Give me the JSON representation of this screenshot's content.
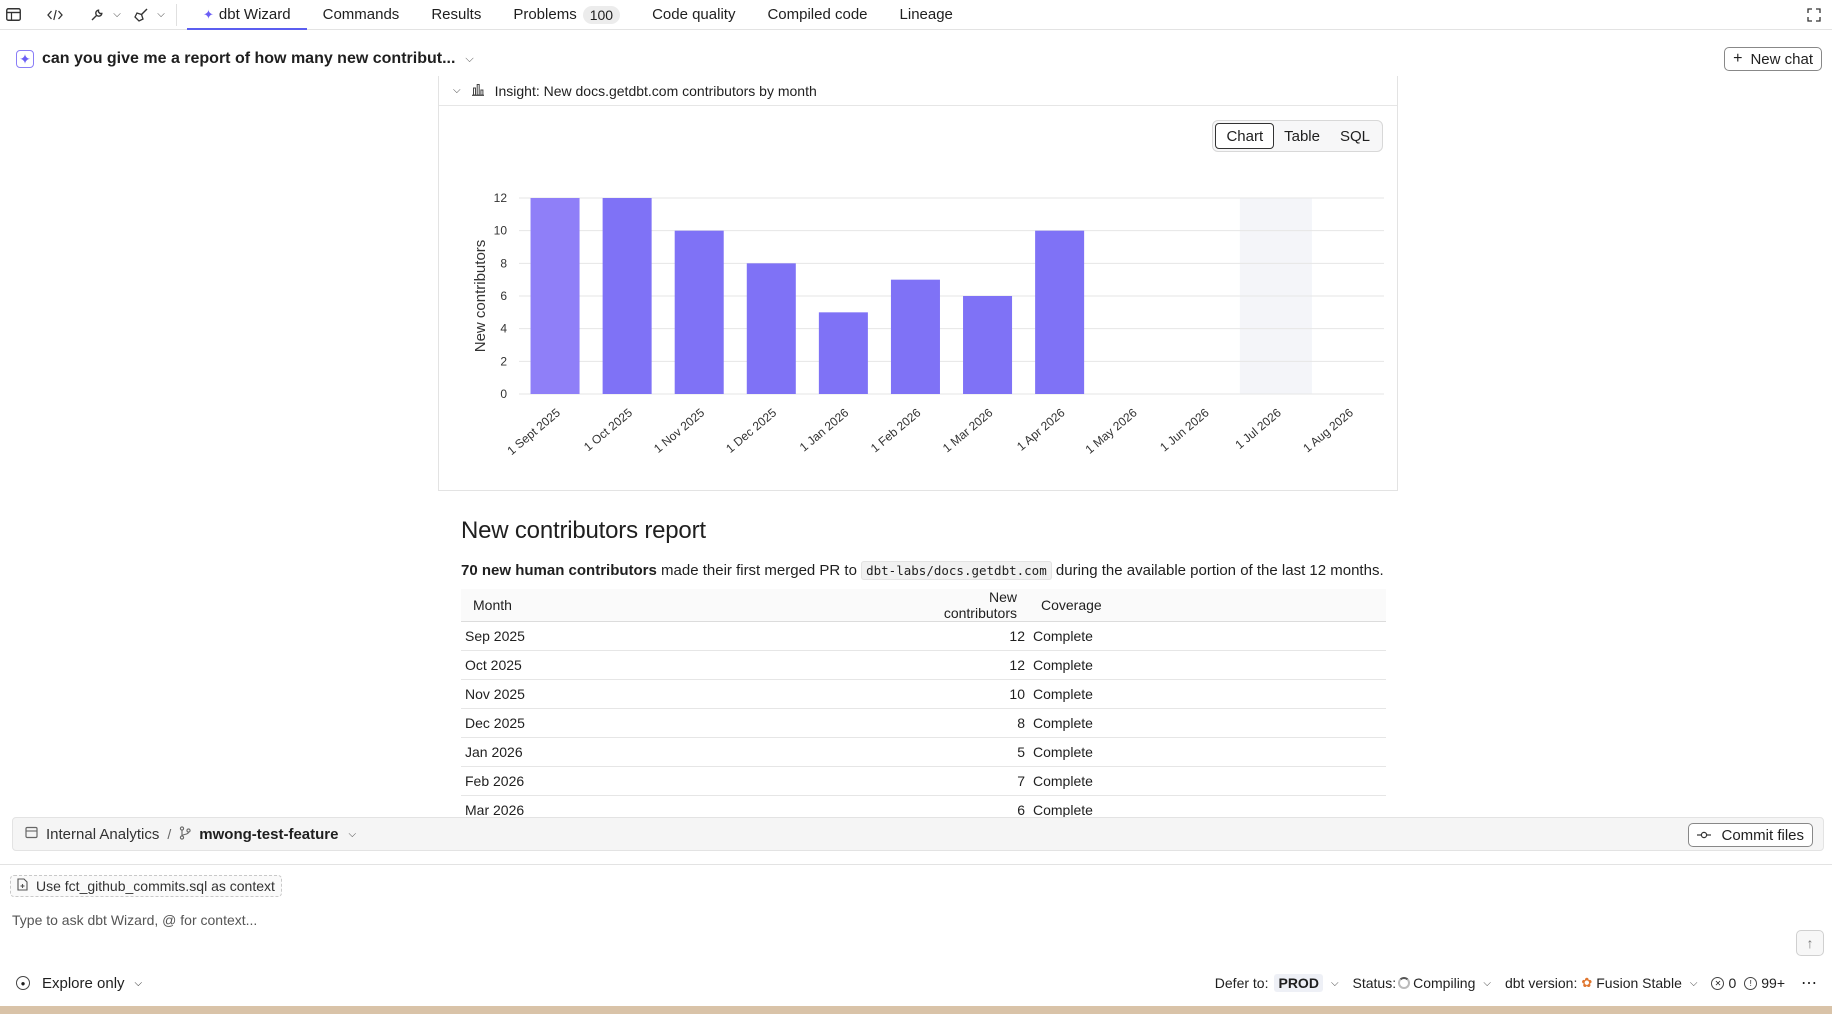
{
  "toolbar": {
    "icons": [
      "table-icon",
      "code-icon",
      "wrench-icon",
      "broom-icon"
    ],
    "tabs": [
      {
        "label": "dbt Wizard",
        "active": true
      },
      {
        "label": "Commands"
      },
      {
        "label": "Results"
      },
      {
        "label": "Problems",
        "badge": "100"
      },
      {
        "label": "Code quality"
      },
      {
        "label": "Compiled code"
      },
      {
        "label": "Lineage"
      }
    ]
  },
  "chat": {
    "title": "can you give me a report of how many new contribut...",
    "new_chat_label": "New chat"
  },
  "insight": {
    "title": "Insight: New docs.getdbt.com contributors by month",
    "view_options": [
      "Chart",
      "Table",
      "SQL"
    ],
    "active_view": "Chart"
  },
  "chart_data": {
    "type": "bar",
    "categories": [
      "1 Sept 2025",
      "1 Oct 2025",
      "1 Nov 2025",
      "1 Dec 2025",
      "1 Jan 2026",
      "1 Feb 2026",
      "1 Mar 2026",
      "1 Apr 2026",
      "1 May 2026",
      "1 Jun 2026",
      "1 Jul 2026",
      "1 Aug 2026"
    ],
    "values": [
      12,
      12,
      10,
      8,
      5,
      7,
      6,
      10,
      null,
      null,
      null,
      null
    ],
    "ylabel": "New contributors",
    "xlabel": "",
    "ylim": [
      0,
      12
    ],
    "yticks": [
      0,
      2,
      4,
      6,
      8,
      10,
      12
    ],
    "grid": true,
    "highlighted_category": "1 Jul 2026",
    "bar_color": "#7f72f6",
    "first_bar_color": "#8f7ff8"
  },
  "report": {
    "heading": "New contributors report",
    "summary_bold": "70 new human contributors",
    "summary_mid": " made their first merged PR to ",
    "summary_code": "dbt-labs/docs.getdbt.com",
    "summary_end": " during the available portion of the last 12 months.",
    "columns": [
      "Month",
      "New contributors",
      "Coverage"
    ],
    "rows": [
      {
        "month": "Sep 2025",
        "count": "12",
        "coverage": "Complete"
      },
      {
        "month": "Oct 2025",
        "count": "12",
        "coverage": "Complete"
      },
      {
        "month": "Nov 2025",
        "count": "10",
        "coverage": "Complete"
      },
      {
        "month": "Dec 2025",
        "count": "8",
        "coverage": "Complete"
      },
      {
        "month": "Jan 2026",
        "count": "5",
        "coverage": "Complete"
      },
      {
        "month": "Feb 2026",
        "count": "7",
        "coverage": "Complete"
      },
      {
        "month": "Mar 2026",
        "count": "6",
        "coverage": "Complete"
      }
    ]
  },
  "branchbar": {
    "project": "Internal Analytics",
    "separator": "/",
    "branch": "mwong-test-feature",
    "commit_label": "Commit files"
  },
  "composer": {
    "context_chip": "Use fct_github_commits.sql as context",
    "placeholder": "Type to ask dbt Wizard, @ for context..."
  },
  "statusbar": {
    "mode": "Explore only",
    "defer_label": "Defer to:",
    "defer_value": "PROD",
    "status_label": "Status:",
    "status_value": "Compiling",
    "version_label": "dbt version:",
    "version_value": "Fusion Stable",
    "errors": "0",
    "warnings": "99+"
  },
  "colors": {
    "accent": "#5b5ef0",
    "bar": "#7f72f6"
  }
}
